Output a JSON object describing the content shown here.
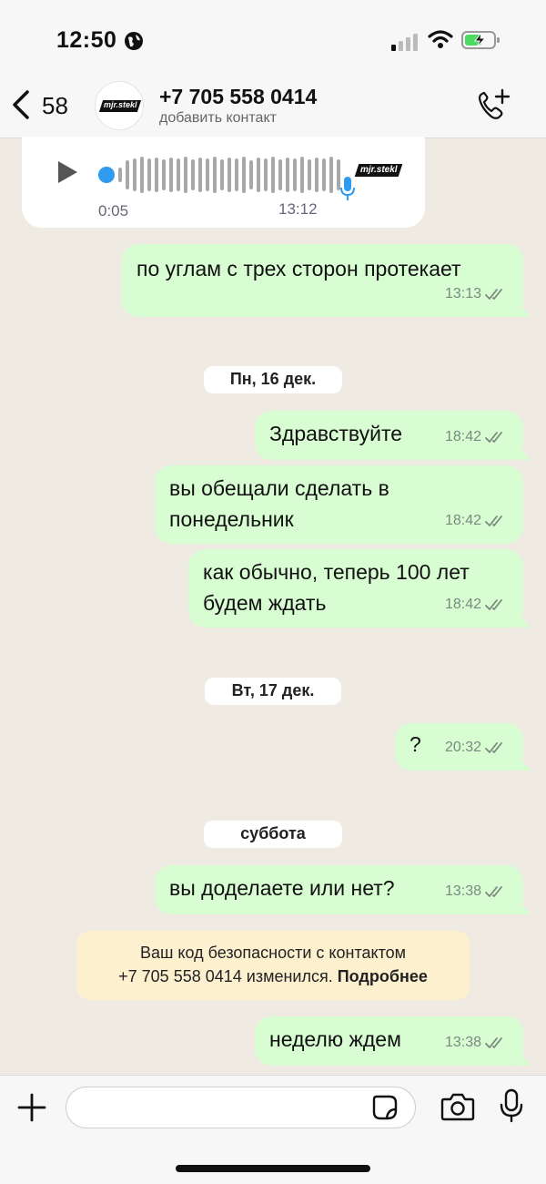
{
  "status_bar": {
    "time": "12:50"
  },
  "header": {
    "back_count": "58",
    "avatar_logo": "mjr.stekl",
    "contact_name": "+7 705 558 0414",
    "contact_subtitle": "добавить контакт"
  },
  "voice_message": {
    "duration": "0:05",
    "time": "13:12",
    "avatar_logo": "mjr.stekl"
  },
  "messages": [
    {
      "text": "по углам с трех сторон протекает",
      "time": "13:13"
    },
    {
      "text": "Здравствуйте",
      "time": "18:42"
    },
    {
      "line1": "вы обещали сделать в",
      "line2": "понедельник",
      "time": "18:42"
    },
    {
      "line1": "как обычно, теперь 100 лет",
      "line2": "будем ждать",
      "time": "18:42"
    },
    {
      "text": "?",
      "time": "20:32"
    },
    {
      "text": "вы доделаете или нет?",
      "time": "13:38"
    },
    {
      "text": "неделю ждем",
      "time": "13:38"
    }
  ],
  "date_chips": [
    "Пн, 16 дек.",
    "Вт, 17 дек.",
    "суббота"
  ],
  "security_note": {
    "line1": "Ваш код безопасности с контактом",
    "line2": "+7 705 558 0414 изменился.",
    "link": "Подробнее"
  },
  "input": {
    "placeholder": "",
    "value": ""
  },
  "colors": {
    "outgoing_bubble": "#d9fdd3",
    "incoming_bubble": "#ffffff",
    "chat_background": "#efeae2",
    "security_note_bg": "#fdf0cf",
    "read_ticks": "#7a8a7f"
  },
  "icons": [
    "globe-icon",
    "signal-icon",
    "wifi-icon",
    "battery-charging-icon",
    "back-chevron-icon",
    "call-add-icon",
    "play-icon",
    "waveform-icon",
    "mic-icon",
    "plus-icon",
    "sticker-icon",
    "camera-icon",
    "double-check-icon"
  ]
}
